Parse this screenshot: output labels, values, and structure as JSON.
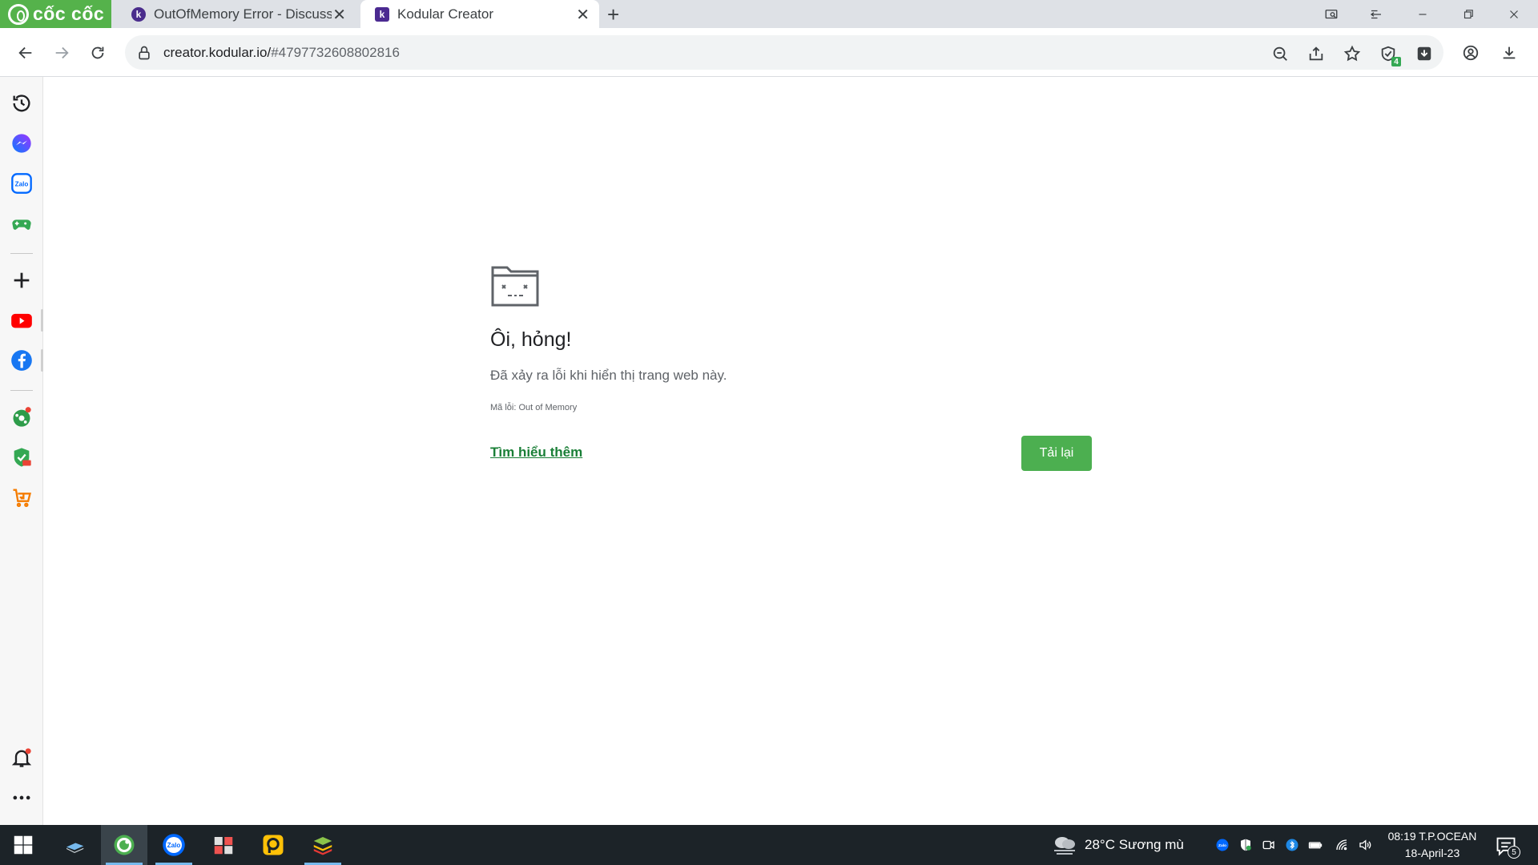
{
  "browser": {
    "brand_text": "cốc cốc",
    "tabs": [
      {
        "title": "OutOfMemory Error - Discuss",
        "favicon_letter": "k"
      },
      {
        "title": "Kodular Creator",
        "favicon_letter": "k"
      }
    ],
    "address": {
      "host": "creator.kodular.io/",
      "path": "#4797732608802816"
    },
    "extension_badge": "4"
  },
  "error_page": {
    "title": "Ôi, hỏng!",
    "message": "Đã xảy ra lỗi khi hiển thị trang web này.",
    "code_text": "Mã lỗi: Out of Memory",
    "learn_more_label": "Tìm hiểu thêm",
    "reload_label": "Tải lại"
  },
  "taskbar": {
    "weather_text": "28°C  Sương mù",
    "time": "08:19 T.P.OCEAN",
    "date": "18-April-23",
    "notification_count": "5"
  },
  "colors": {
    "brand_green": "#55b24b",
    "reload_green": "#4caf50",
    "link_green": "#1a7f37",
    "taskbar_bg": "#1c2328"
  }
}
